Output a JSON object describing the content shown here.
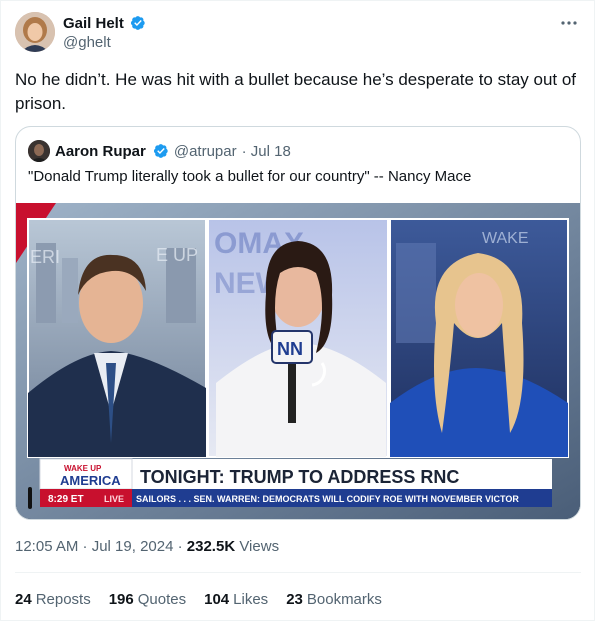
{
  "tweet": {
    "author_name": "Gail Helt",
    "handle": "@ghelt",
    "more_icon": "more-horizontal-icon",
    "text": "No he didn’t. He was hit with a bullet because he’s desperate to stay out of prison.",
    "quoted": {
      "author_name": "Aaron Rupar",
      "handle": "@atrupar",
      "date": "· Jul 18",
      "text": "\"Donald Trump literally took a bullet for our country\" -- Nancy Mace",
      "media": {
        "show_logo_line1": "WAKE UP",
        "show_logo_line2": "AMERICA",
        "headline": "TONIGHT: TRUMP TO ADDRESS RNC",
        "time": "8:29 ET",
        "live": "LIVE",
        "ticker": "SAILORS . . .     SEN. WARREN: DEMOCRATS WILL CODIFY ROE WITH NOVEMBER VICTOR",
        "mic_flag": "NN"
      }
    },
    "timestamp": "12:05 AM · Jul 19, 2024 · ",
    "views_count": "232.5K",
    "views_label": " Views",
    "stats": [
      {
        "count": "24",
        "label": "Reposts"
      },
      {
        "count": "196",
        "label": "Quotes"
      },
      {
        "count": "104",
        "label": "Likes"
      },
      {
        "count": "23",
        "label": "Bookmarks"
      }
    ],
    "colors": {
      "verified": "#1d9bf0",
      "text": "#0f1419",
      "secondary": "#536471",
      "border": "#cfd9de"
    }
  }
}
